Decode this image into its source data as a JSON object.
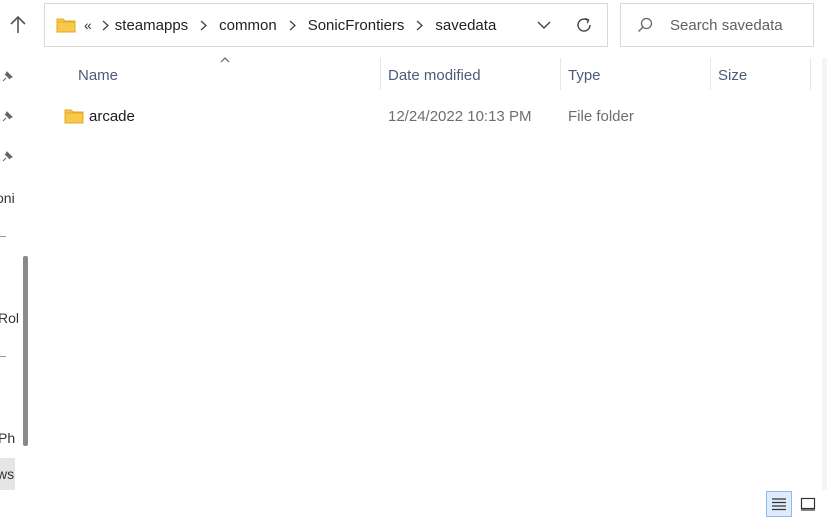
{
  "address": {
    "overflow_label": "«",
    "breadcrumbs": [
      {
        "label": "steamapps"
      },
      {
        "label": "common"
      },
      {
        "label": "SonicFrontiers"
      },
      {
        "label": "savedata"
      }
    ]
  },
  "search": {
    "placeholder": "Search savedata"
  },
  "nav": {
    "partial_labels": [
      "oni",
      "Rol",
      "Ph",
      "ws"
    ]
  },
  "columns": {
    "name": "Name",
    "date_modified": "Date modified",
    "type": "Type",
    "size": "Size"
  },
  "files": [
    {
      "name": "arcade",
      "date_modified": "12/24/2022 10:13 PM",
      "type": "File folder",
      "size": ""
    }
  ],
  "colors": {
    "folder_yellow": "#f8c94a",
    "folder_dark": "#e3a924",
    "header_text": "#4d5b78",
    "selected_view": "#dcecfb"
  }
}
